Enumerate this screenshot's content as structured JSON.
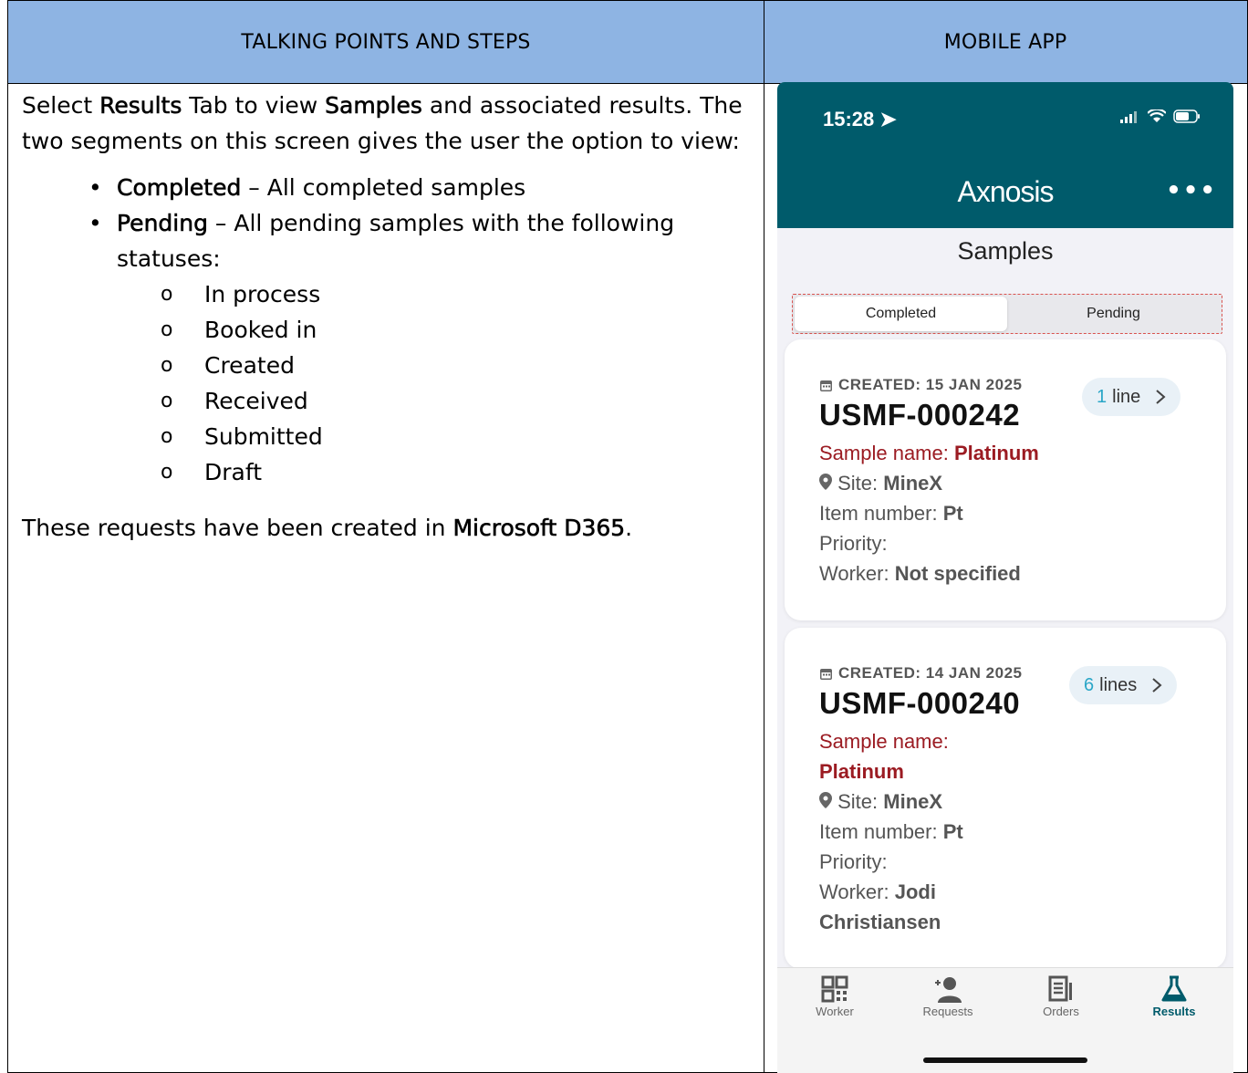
{
  "header": {
    "left_title": "TALKING POINTS AND STEPS",
    "right_title": "MOBILE APP"
  },
  "content": {
    "intro_1": "Select ",
    "intro_bold_1": "Results",
    "intro_2": " Tab to view ",
    "intro_bold_2": "Samples",
    "intro_3": " and associated results. The two segments on this screen gives the user the option to view:",
    "bullets": [
      {
        "bold": "Completed",
        "text": " – All completed samples"
      },
      {
        "bold": "Pending",
        "text": " – All pending samples with the following statuses:"
      }
    ],
    "statuses": [
      "In process",
      "Booked in",
      "Created",
      "Received",
      "Submitted",
      "Draft"
    ],
    "closing_1": "These requests have been created in ",
    "closing_bold": "Microsoft D365",
    "closing_2": "."
  },
  "phone": {
    "time": "15:28",
    "logo": "Axnosis",
    "more": "•••",
    "screen_title": "Samples",
    "segments": [
      "Completed",
      "Pending"
    ],
    "cards": [
      {
        "created": "CREATED: 15 JAN 2025",
        "id": "USMF-000242",
        "lines_num": "1",
        "lines_word": "line",
        "sample_label": "Sample name: ",
        "sample_value": "Platinum",
        "site_label": "Site: ",
        "site_value": "MineX",
        "item_label": "Item number: ",
        "item_value": "Pt",
        "priority_label": "Priority:",
        "worker_label": "Worker: ",
        "worker_value": "Not specified"
      },
      {
        "created": "CREATED: 14 JAN 2025",
        "id": "USMF-000240",
        "lines_num": "6",
        "lines_word": "lines",
        "sample_label": "Sample name:",
        "sample_value": "Platinum",
        "site_label": "Site: ",
        "site_value": "MineX",
        "item_label": "Item number: ",
        "item_value": "Pt",
        "priority_label": "Priority:",
        "worker_label": "Worker: ",
        "worker_value_1": "Jodi",
        "worker_value_2": "Christiansen"
      }
    ],
    "tabs": [
      "Worker",
      "Requests",
      "Orders",
      "Results"
    ],
    "colors": {
      "appbar": "#005b6b",
      "accent_red": "#9b1b22",
      "lines_num": "#2aa6c7"
    }
  }
}
